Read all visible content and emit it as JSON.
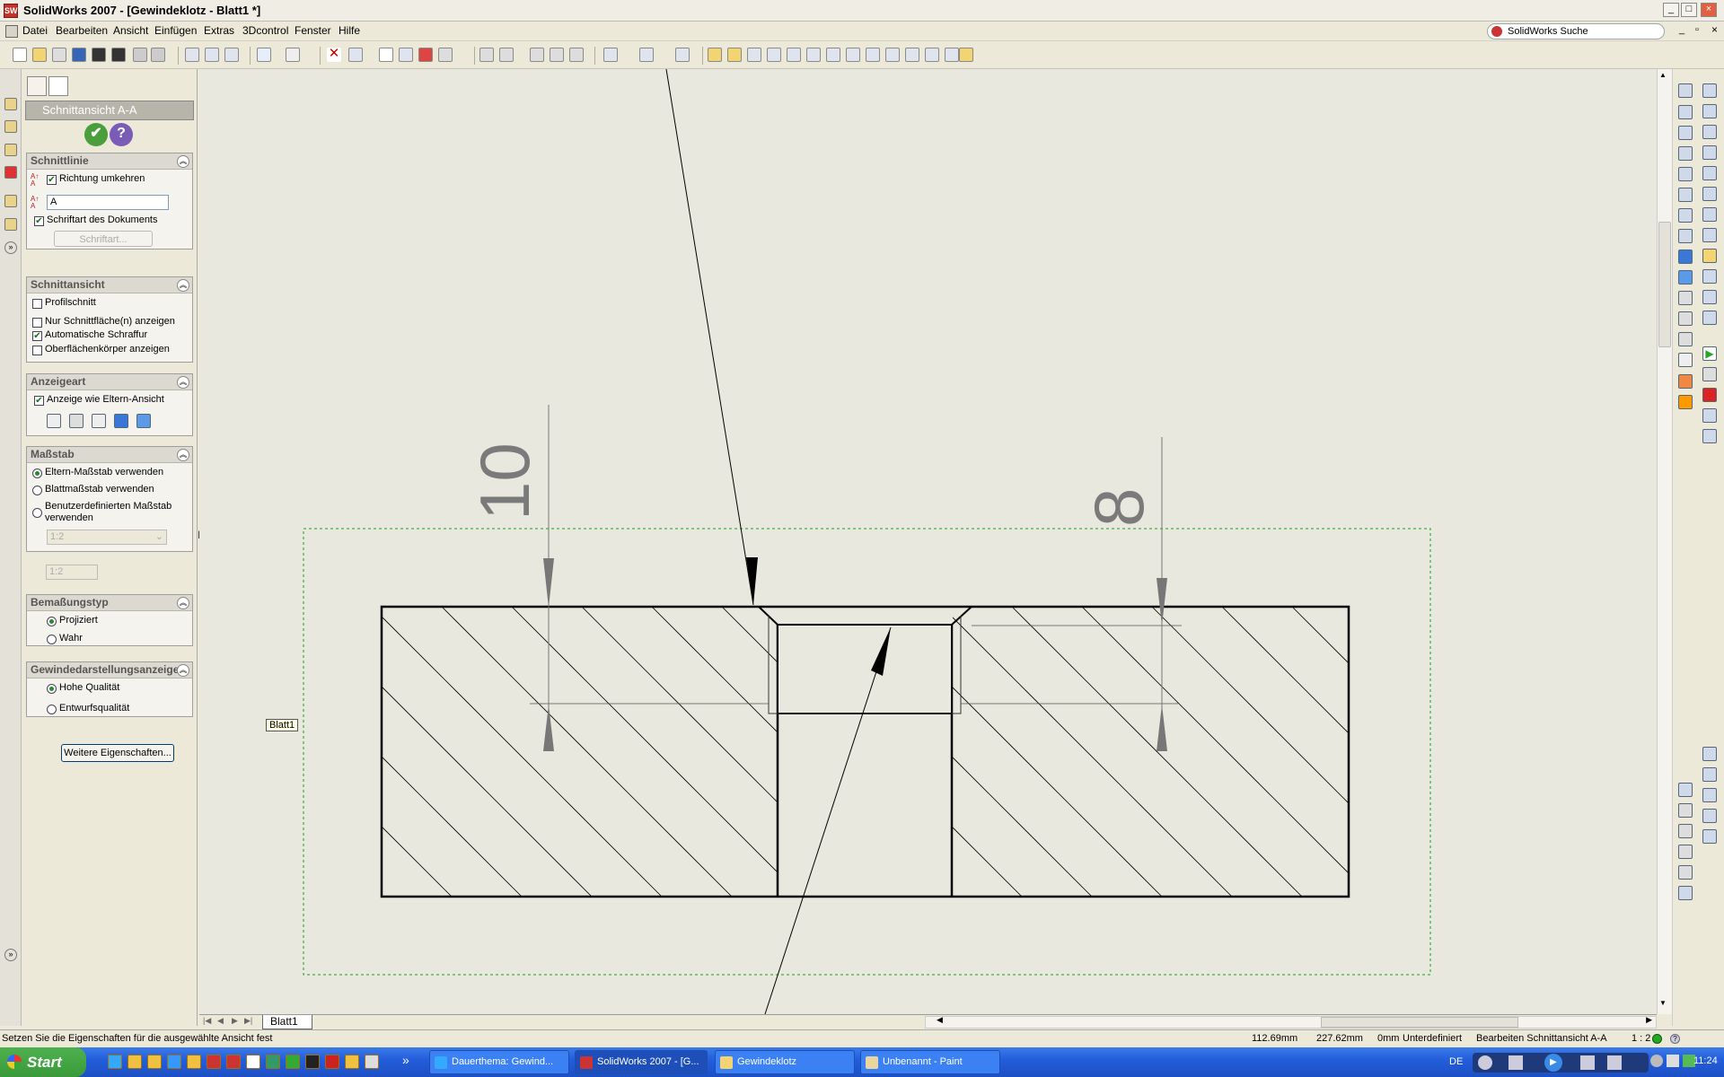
{
  "window": {
    "title": "SolidWorks 2007 - [Gewindeklotz - Blatt1 *]",
    "app_icon": "SW"
  },
  "menu": [
    "Datei",
    "Bearbeiten",
    "Ansicht",
    "Einfügen",
    "Extras",
    "3Dcontrol",
    "Fenster",
    "Hilfe"
  ],
  "search": {
    "label": "SolidWorks Suche"
  },
  "panel": {
    "title": "Schnittansicht A-A",
    "ok_symbol": "✔",
    "help_symbol": "?",
    "groups": {
      "schnittlinie": {
        "header": "Schnittlinie",
        "richtung": "Richtung umkehren",
        "label_value": "A",
        "schriftart_dok": "Schriftart des Dokuments",
        "schriftart_btn": "Schriftart..."
      },
      "schnittansicht": {
        "header": "Schnittansicht",
        "profilschnitt": "Profilschnitt",
        "nur_schnitt": "Nur Schnittfläche(n) anzeigen",
        "auto_schraffur": "Automatische Schraffur",
        "oberflaechen": "Oberflächenkörper anzeigen"
      },
      "anzeigeart": {
        "header": "Anzeigeart",
        "wie_eltern": "Anzeige wie Eltern-Ansicht"
      },
      "massstab": {
        "header": "Maßstab",
        "eltern": "Eltern-Maßstab verwenden",
        "blatt": "Blattmaßstab verwenden",
        "benutzer_1": "Benutzerdefinierten Maßstab",
        "benutzer_2": "verwenden",
        "select_value": "1:2",
        "field_value": "1:2"
      },
      "bemassung": {
        "header": "Bemaßungstyp",
        "projiziert": "Projiziert",
        "wahr": "Wahr"
      },
      "gewinde": {
        "header": "Gewindedarstellungsanzeige",
        "hohe": "Hohe Qualität",
        "entwurf": "Entwurfsqualität"
      }
    },
    "more_btn": "Weitere Eigenschaften..."
  },
  "drawing": {
    "dim_left": "10",
    "dim_right": "8",
    "sheet_tooltip": "Blatt1",
    "hatch_angle_deg": 45
  },
  "sheet_tab": "Blatt1",
  "status": {
    "hint": "Setzen Sie die Eigenschaften für die ausgewählte Ansicht fest",
    "x": "112.69mm",
    "y": "227.62mm",
    "z": "0mm",
    "state": "Unterdefiniert",
    "mode": "Bearbeiten Schnittansicht A-A",
    "scale": "1 : 2"
  },
  "taskbar": {
    "start": "Start",
    "tasks": [
      "Dauerthema: Gewind...",
      "SolidWorks 2007 - [G...",
      "Gewindeklotz",
      "Unbenannt - Paint"
    ],
    "more": "»",
    "lang": "DE",
    "clock": "11:24"
  },
  "colors": {
    "canvas": "#e8e8de",
    "selection": "#1aa01a",
    "dimension": "#7a7a7a"
  }
}
